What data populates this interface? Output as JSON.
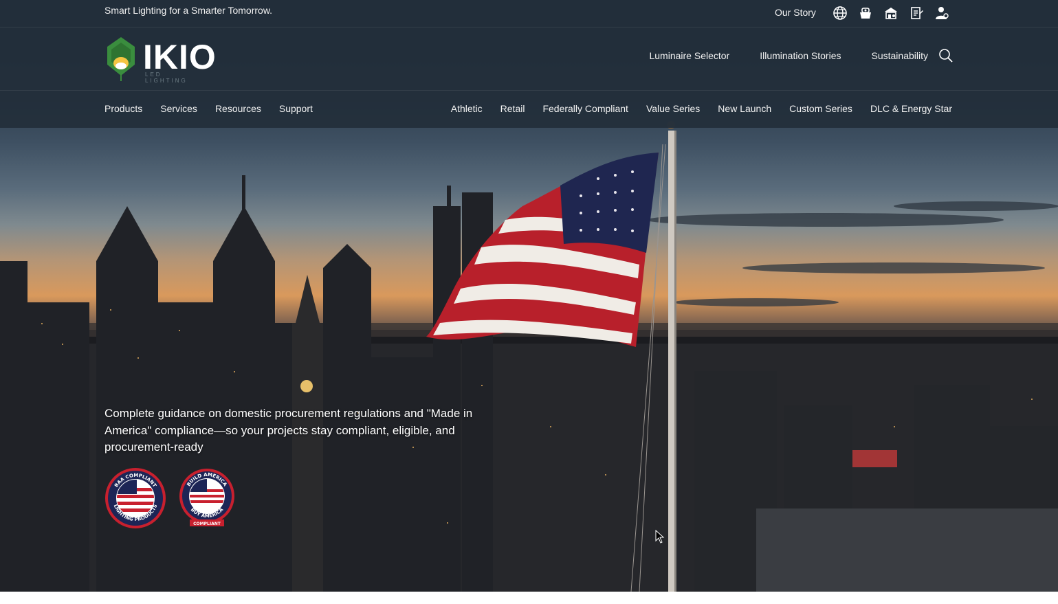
{
  "topbar": {
    "tagline": "Smart Lighting for a Smarter Tomorrow.",
    "our_story": "Our Story",
    "icons": [
      "globe-icon",
      "cart-icon",
      "store-icon",
      "clipboard-icon",
      "user-icon"
    ]
  },
  "brand": {
    "name": "IKIO",
    "subtitle": "LED LIGHTING",
    "green": "#3a8d3e",
    "yellow": "#f4c542"
  },
  "mainnav": {
    "items": [
      "Luminaire Selector",
      "Illumination Stories",
      "Sustainability"
    ]
  },
  "nav_left": [
    "Products",
    "Services",
    "Resources",
    "Support"
  ],
  "nav_right": [
    "Athletic",
    "Retail",
    "Federally Compliant",
    "Value Series",
    "New Launch",
    "Custom Series",
    "DLC & Energy Star"
  ],
  "hero": {
    "text": "Complete guidance on domestic procurement regulations and \"Made in America\" compliance—so your projects stay compliant, eligible, and procurement-ready",
    "badges": [
      {
        "top": "BAA COMPLIANT",
        "bottom": "LIGHTING PRODUCTS"
      },
      {
        "top": "BUILD AMERICA",
        "bottom": "BUY AMERICA",
        "ribbon": "COMPLIANT"
      }
    ]
  },
  "colors": {
    "header_bg": "#222e3a",
    "text": "#f2f2f2"
  }
}
